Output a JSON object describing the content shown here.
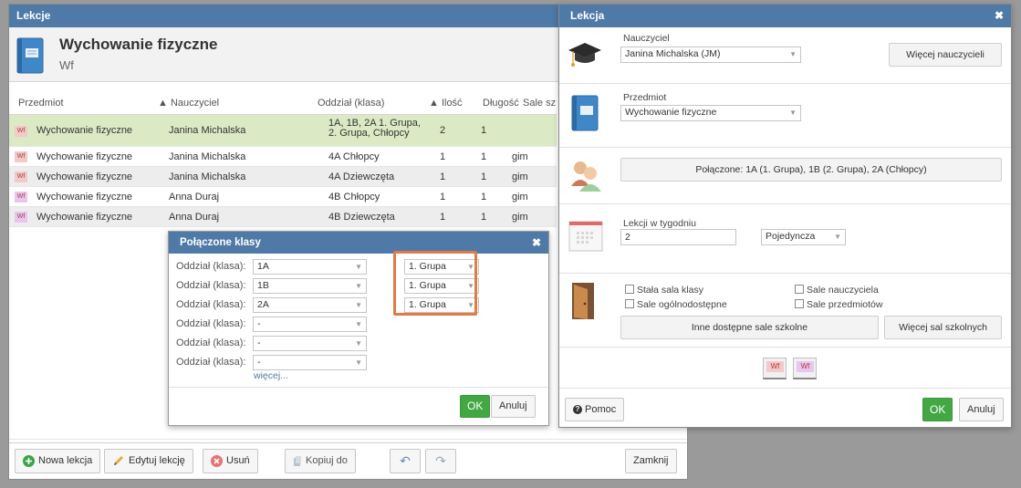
{
  "lessons_window": {
    "title": "Lekcje",
    "subject_name": "Wychowanie fizyczne",
    "subject_short": "Wf",
    "columns": [
      "Przedmiot",
      "▲ Nauczyciel",
      "Oddział (klasa)",
      "▲ Ilość",
      "Długość",
      "Sale sz"
    ],
    "rows": [
      {
        "badge": "Wf",
        "subject": "Wychowanie fizyczne",
        "teacher": "Janina Michalska",
        "cls": "1A, 1B, 2A 1. Grupa, 2. Grupa, Chłopcy",
        "count": "2",
        "length": "1",
        "room": ""
      },
      {
        "badge": "Wf",
        "subject": "Wychowanie fizyczne",
        "teacher": "Janina Michalska",
        "cls": "4A Chłopcy",
        "count": "1",
        "length": "1",
        "room": "gim"
      },
      {
        "badge": "Wf",
        "subject": "Wychowanie fizyczne",
        "teacher": "Janina Michalska",
        "cls": "4A Dziewczęta",
        "count": "1",
        "length": "1",
        "room": "gim"
      },
      {
        "badge": "Wf",
        "subject": "Wychowanie fizyczne",
        "teacher": "Anna Duraj",
        "cls": "4B Chłopcy",
        "count": "1",
        "length": "1",
        "room": "gim"
      },
      {
        "badge": "Wf",
        "subject": "Wychowanie fizyczne",
        "teacher": "Anna Duraj",
        "cls": "4B Dziewczęta",
        "count": "1",
        "length": "1",
        "room": "gim"
      }
    ],
    "toolbar": {
      "new": "Nowa lekcja",
      "edit": "Edytuj lekcję",
      "delete": "Usuń",
      "copy": "Kopiuj do",
      "undo": "↶",
      "redo": "↷",
      "close": "Zamknij"
    }
  },
  "joined_popup": {
    "title": "Połączone klasy",
    "close": "✖",
    "rows": [
      {
        "label": "Oddział (klasa):",
        "cls": "1A",
        "group": "1. Grupa"
      },
      {
        "label": "Oddział (klasa):",
        "cls": "1B",
        "group": "1. Grupa"
      },
      {
        "label": "Oddział (klasa):",
        "cls": "2A",
        "group": "1. Grupa"
      },
      {
        "label": "Oddział (klasa):",
        "cls": "-",
        "group": ""
      },
      {
        "label": "Oddział (klasa):",
        "cls": "-",
        "group": ""
      },
      {
        "label": "Oddział (klasa):",
        "cls": "-",
        "group": ""
      }
    ],
    "more": "więcej...",
    "ok": "OK",
    "cancel": "Anuluj"
  },
  "lesson_window": {
    "title": "Lekcja",
    "close": "✖",
    "teacher_label": "Nauczyciel",
    "teacher_value": "Janina Michalska (JM)",
    "more_teachers": "Więcej nauczycieli",
    "subject_label": "Przedmiot",
    "subject_value": "Wychowanie fizyczne",
    "joined_button": "Połączone: 1A (1. Grupa), 1B (2. Grupa), 2A (Chłopcy)",
    "weekly_label": "Lekcji w tygodniu",
    "weekly_value": "2",
    "single_value": "Pojedyncza",
    "chk_class_room": "Stała sala klasy",
    "chk_teacher_rooms": "Sale nauczyciela",
    "chk_public_rooms": "Sale ogólnodostępne",
    "chk_subject_rooms": "Sale przedmiotów",
    "other_rooms": "Inne dostępne sale szkolne",
    "more_rooms": "Więcej sal szkolnych",
    "tile1": "Wf",
    "tile2": "Wf",
    "help": "Pomoc",
    "ok": "OK",
    "cancel": "Anuluj"
  },
  "colors": {
    "title_bar": "#4f79a6",
    "selected_row": "#dbeac4",
    "ok_green": "#43a843",
    "highlight": "#e07b45"
  }
}
